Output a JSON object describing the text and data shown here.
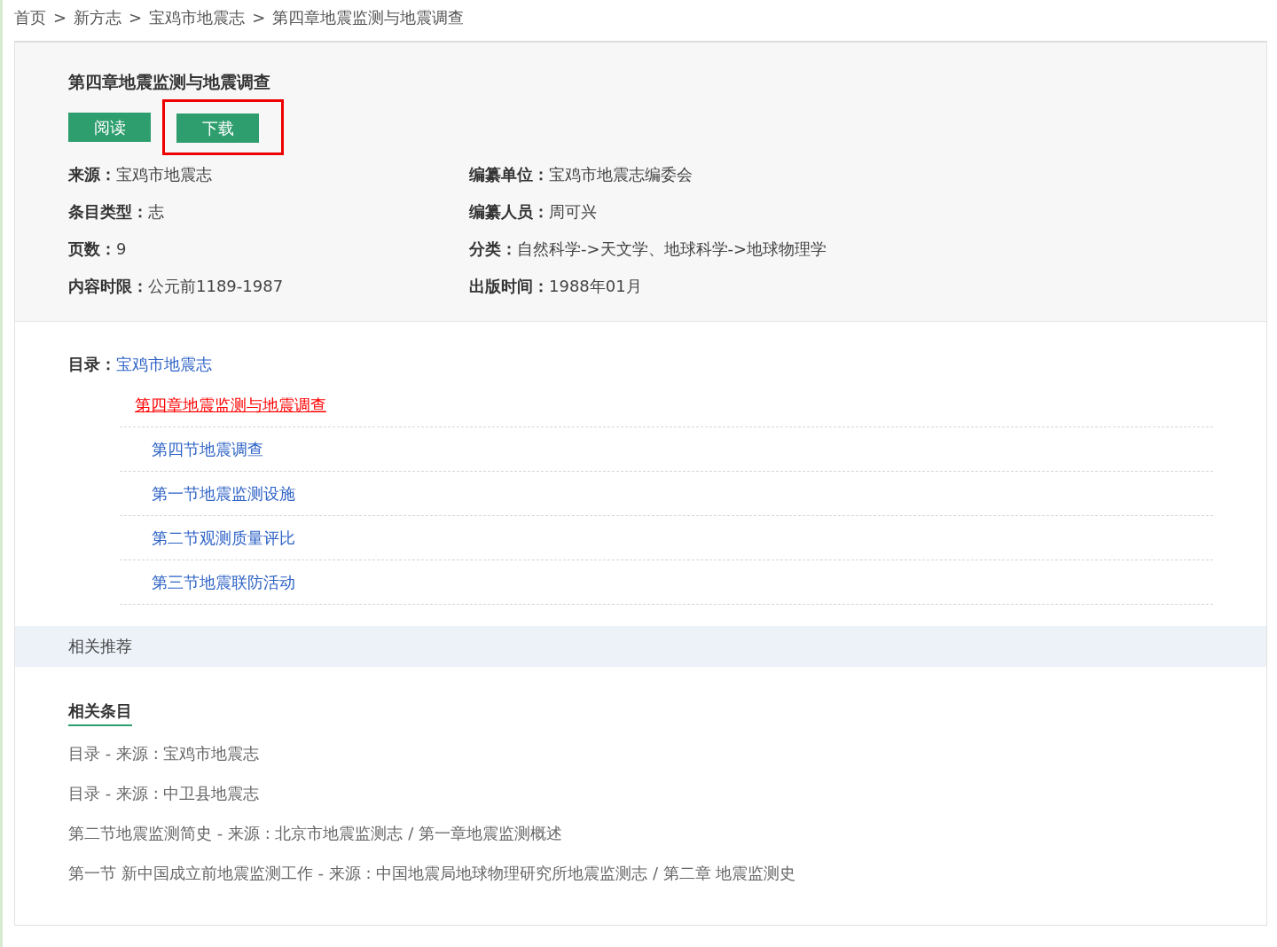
{
  "breadcrumb": {
    "separator": ">",
    "items": [
      "首页",
      "新方志",
      "宝鸡市地震志",
      "第四章地震监测与地震调查"
    ]
  },
  "entry": {
    "title": "第四章地震监测与地震调查",
    "buttons": [
      {
        "label": "阅读",
        "highlighted": false
      },
      {
        "label": "下载",
        "highlighted": true
      }
    ],
    "meta_left": [
      {
        "label": "来源：",
        "value": "宝鸡市地震志"
      },
      {
        "label": "条目类型：",
        "value": "志"
      },
      {
        "label": "页数：",
        "value": "9"
      },
      {
        "label": "内容时限：",
        "value": "公元前1189-1987"
      }
    ],
    "meta_right": [
      {
        "label": "编纂单位：",
        "value": "宝鸡市地震志编委会"
      },
      {
        "label": "编纂人员：",
        "value": "周可兴"
      },
      {
        "label": "分类：",
        "value": "自然科学->天文学、地球科学->地球物理学"
      },
      {
        "label": "出版时间：",
        "value": "1988年01月"
      }
    ]
  },
  "toc": {
    "label": "目录：",
    "root": "宝鸡市地震志",
    "items": [
      {
        "title": "第四章地震监测与地震调查",
        "selected": true,
        "children": [
          {
            "title": "第四节地震调查",
            "selected": false
          },
          {
            "title": "第一节地震监测设施",
            "selected": false
          },
          {
            "title": "第二节观测质量评比",
            "selected": false
          },
          {
            "title": "第三节地震联防活动",
            "selected": false
          }
        ]
      }
    ]
  },
  "recommend": {
    "title": "相关推荐",
    "tab": "相关条目",
    "items": [
      "目录 - 来源 : 宝鸡市地震志",
      "目录 - 来源 : 中卫县地震志",
      "第二节地震监测简史 - 来源 : 北京市地震监测志 / 第一章地震监测概述",
      "第一节 新中国成立前地震监测工作 - 来源 : 中国地震局地球物理研究所地震监测志 / 第二章 地震监测史"
    ]
  }
}
